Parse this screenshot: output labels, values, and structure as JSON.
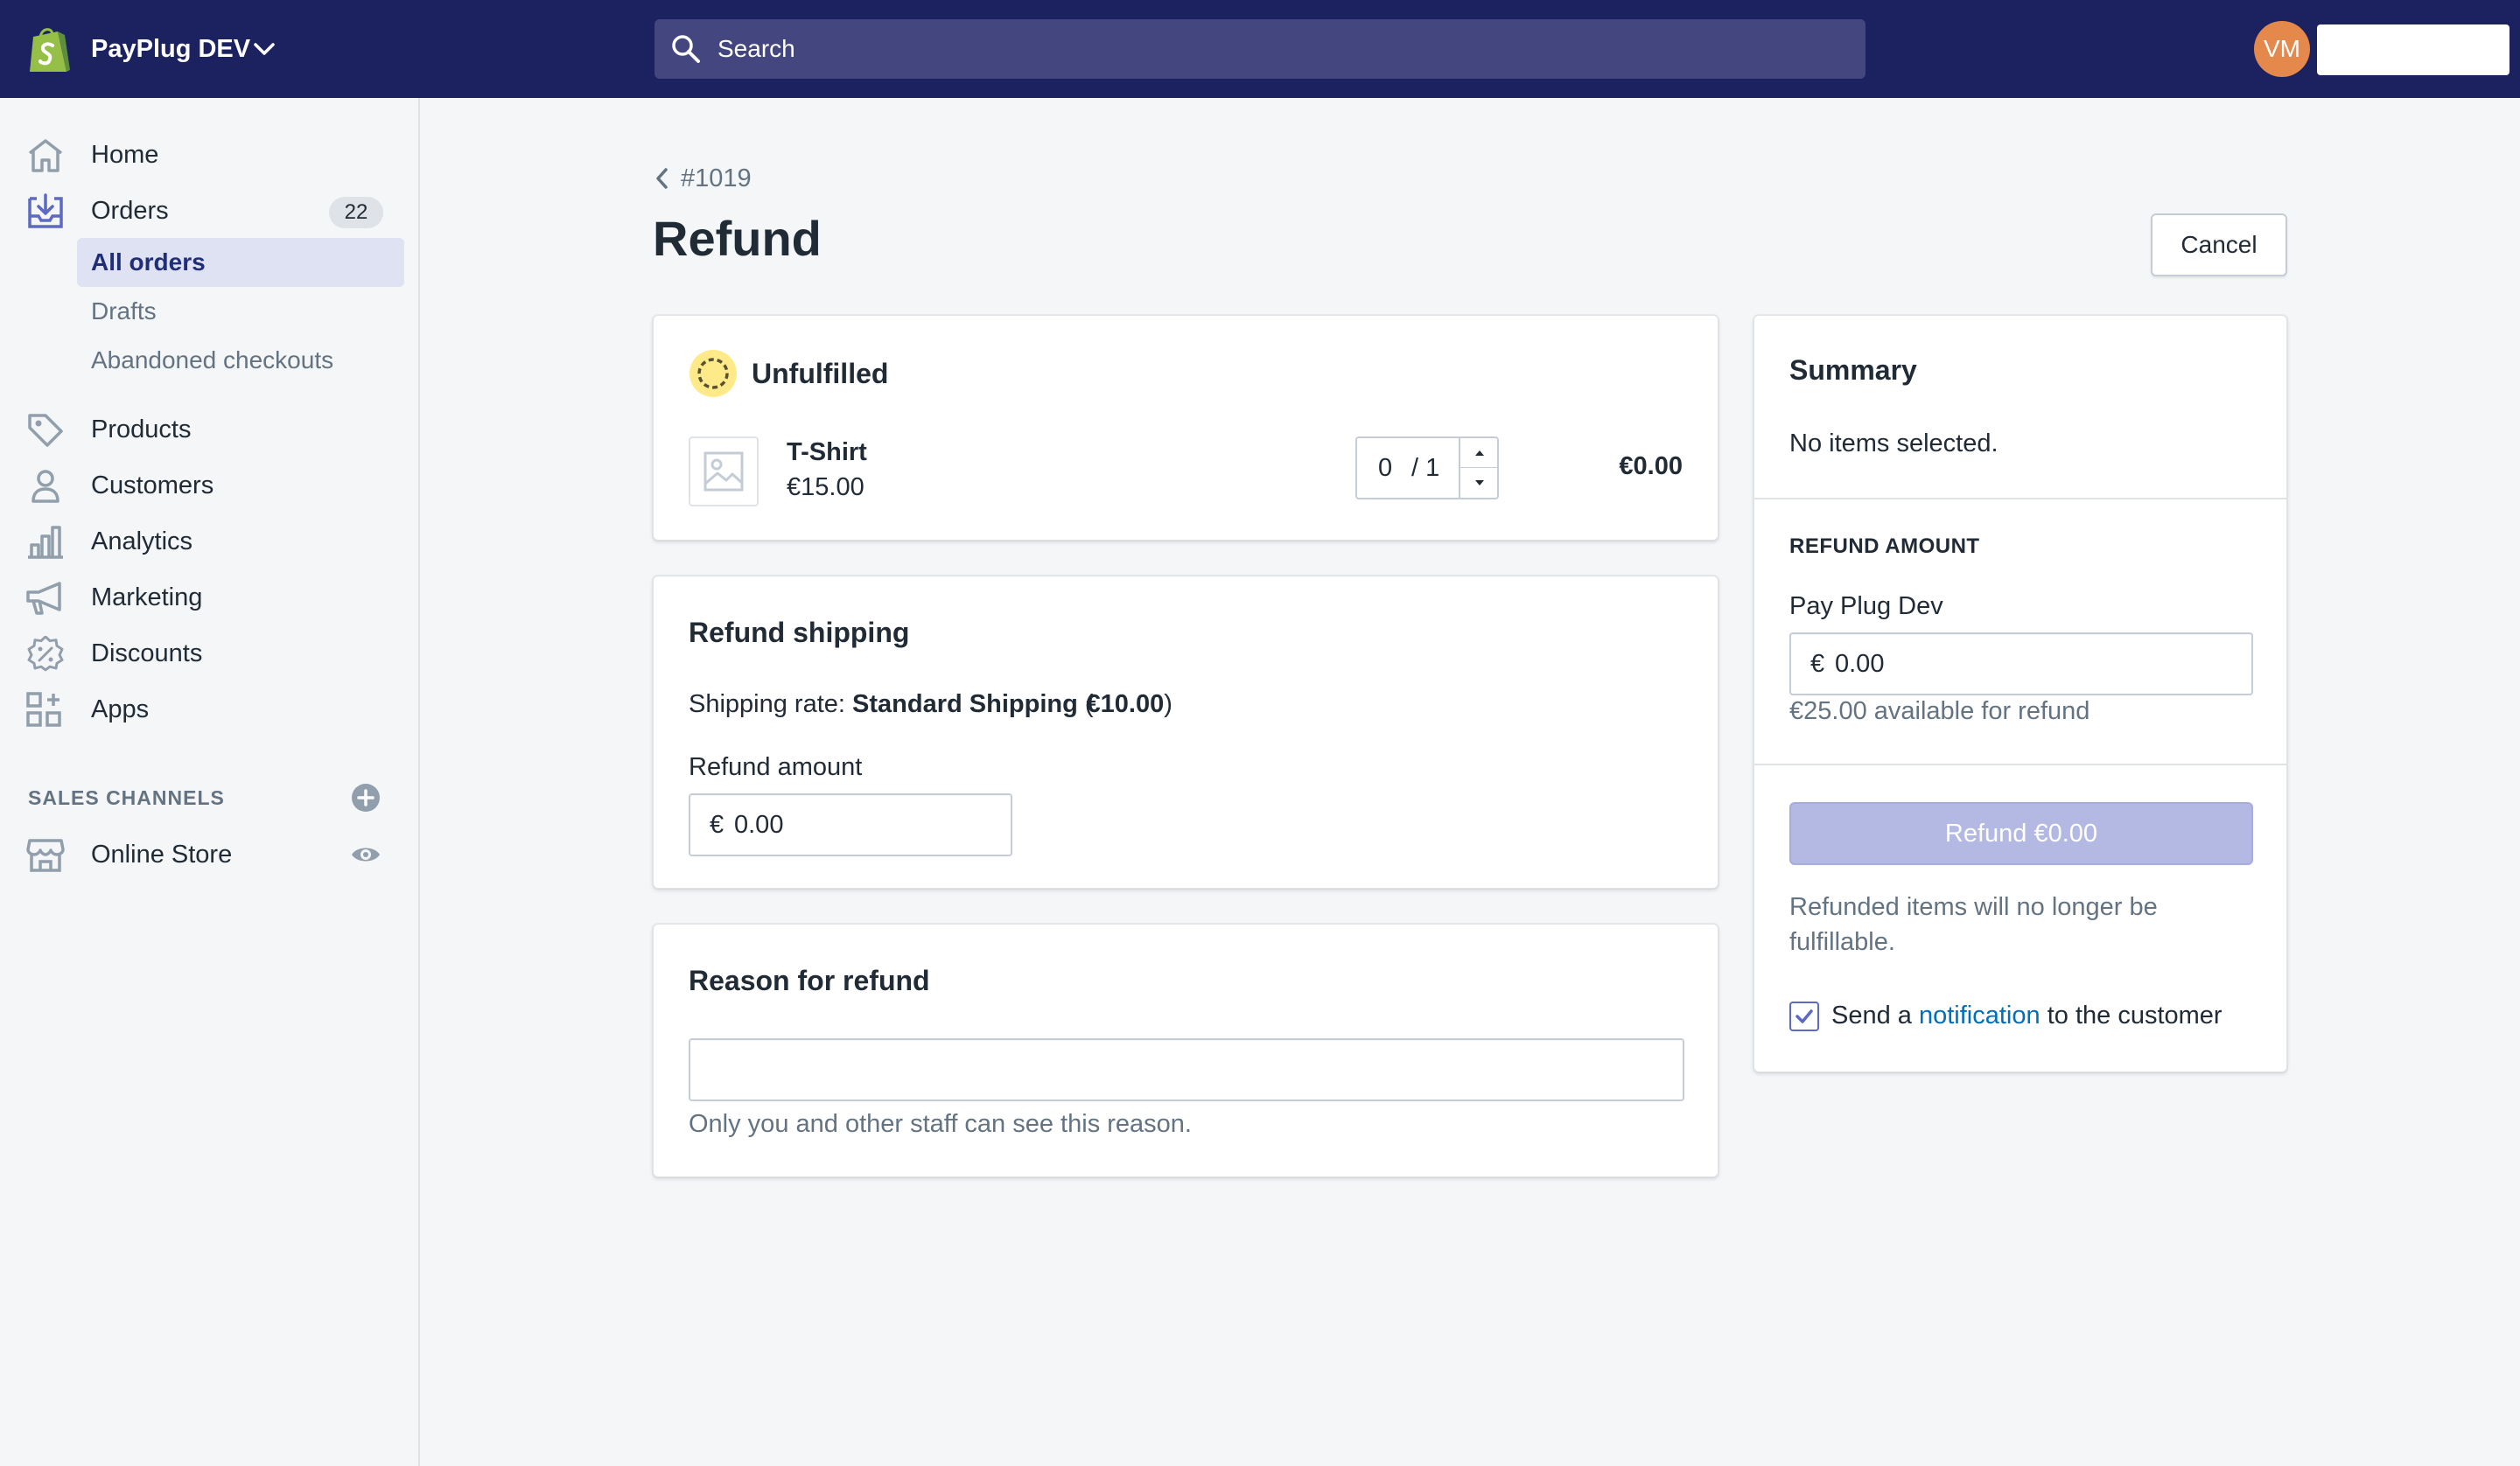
{
  "topbar": {
    "store_name": "PayPlug DEV",
    "search_placeholder": "Search",
    "avatar_initials": "VM"
  },
  "sidebar": {
    "items": [
      {
        "label": "Home",
        "icon": "home-icon"
      },
      {
        "label": "Orders",
        "icon": "orders-icon",
        "badge": "22"
      },
      {
        "label": "Products",
        "icon": "tag-icon"
      },
      {
        "label": "Customers",
        "icon": "person-icon"
      },
      {
        "label": "Analytics",
        "icon": "bar-chart-icon"
      },
      {
        "label": "Marketing",
        "icon": "megaphone-icon"
      },
      {
        "label": "Discounts",
        "icon": "discount-icon"
      },
      {
        "label": "Apps",
        "icon": "apps-icon"
      }
    ],
    "orders_sub": [
      {
        "label": "All orders",
        "active": true
      },
      {
        "label": "Drafts"
      },
      {
        "label": "Abandoned checkouts"
      }
    ],
    "sales_channels_heading": "SALES CHANNELS",
    "online_store": "Online Store"
  },
  "page": {
    "breadcrumb": "#1019",
    "title": "Refund",
    "cancel_label": "Cancel"
  },
  "unfulfilled": {
    "title": "Unfulfilled",
    "item_name": "T-Shirt",
    "item_price": "€15.00",
    "qty_value": "0",
    "qty_total": "/ 1",
    "line_total": "€0.00"
  },
  "shipping": {
    "title": "Refund shipping",
    "rate_prefix": "Shipping rate:",
    "rate_name": "Standard Shipping",
    "rate_amount_open": "(",
    "rate_amount": "€10.00",
    "rate_amount_close": ")",
    "amount_label": "Refund amount",
    "currency": "€",
    "amount_value": "0.00"
  },
  "reason": {
    "title": "Reason for refund",
    "value": "",
    "help": "Only you and other staff can see this reason."
  },
  "summary": {
    "title": "Summary",
    "empty_text": "No items selected.",
    "refund_amount_heading": "REFUND AMOUNT",
    "gateway_label": "Pay Plug Dev",
    "currency": "€",
    "amount_value": "0.00",
    "available": "€25.00 available for refund",
    "refund_button": "Refund €0.00",
    "note_line1": "Refunded items will no longer be",
    "note_line2": "fulfillable.",
    "notify_prefix": "Send a",
    "notify_link": "notification",
    "notify_suffix": "to the customer",
    "notify_checked": true
  },
  "colors": {
    "topbar": "#1c2260",
    "search": "#43467f",
    "accent": "#5c6ac4",
    "avatar": "#e4884c",
    "refund_button_disabled": "#b3b9e3",
    "link": "#006fbb",
    "unfulfilled_badge": "#ffea8a"
  }
}
